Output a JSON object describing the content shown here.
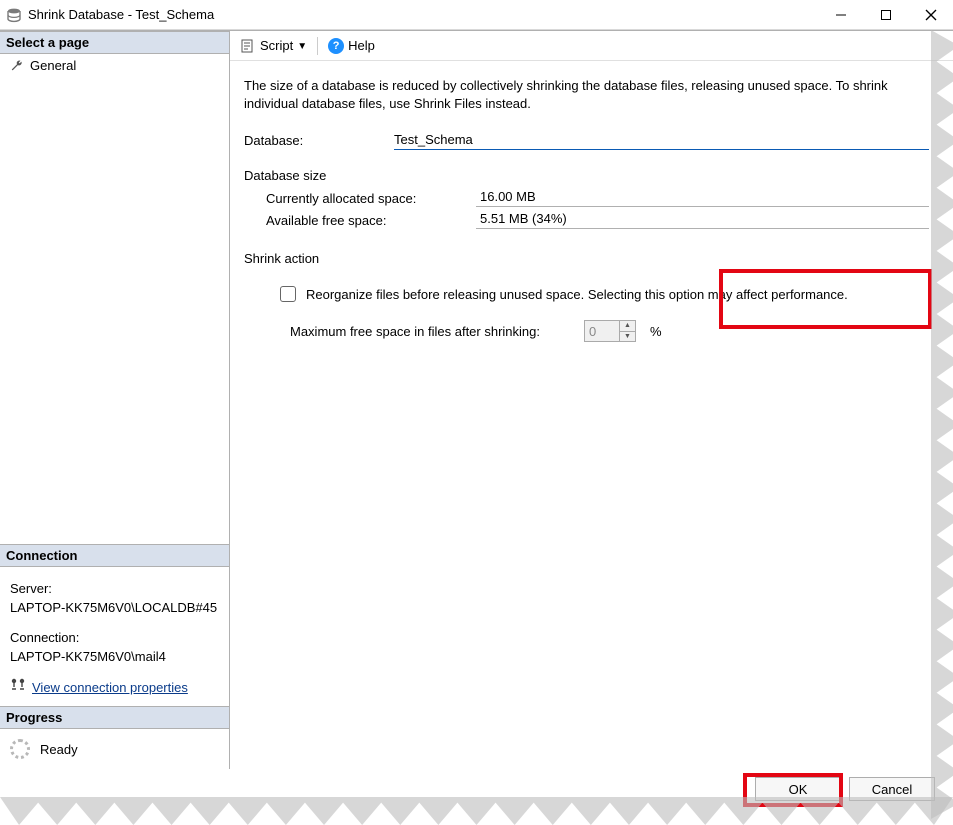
{
  "window": {
    "title": "Shrink Database - Test_Schema"
  },
  "pages": {
    "header": "Select a page",
    "items": [
      {
        "label": "General"
      }
    ]
  },
  "toolbar": {
    "script": "Script",
    "help": "Help"
  },
  "description": "The size of a database is reduced by collectively shrinking the database files, releasing unused space. To shrink individual database files, use Shrink Files instead.",
  "form": {
    "database_label": "Database:",
    "database_value": "Test_Schema",
    "size_header": "Database size",
    "allocated_label": "Currently allocated space:",
    "allocated_value": "16.00 MB",
    "free_label": "Available free space:",
    "free_value": "5.51 MB (34%)",
    "action_header": "Shrink action",
    "reorganize_label": "Reorganize files before releasing unused space.  Selecting this option may affect performance.",
    "maxfree_label": "Maximum free space in files after shrinking:",
    "maxfree_value": "0",
    "percent": "%"
  },
  "connection": {
    "header": "Connection",
    "server_label": "Server:",
    "server_value": "LAPTOP-KK75M6V0\\LOCALDB#45",
    "conn_label": "Connection:",
    "conn_value": "LAPTOP-KK75M6V0\\mail4",
    "link": "View connection properties"
  },
  "progress": {
    "header": "Progress",
    "status": "Ready"
  },
  "buttons": {
    "ok": "OK",
    "cancel": "Cancel"
  }
}
